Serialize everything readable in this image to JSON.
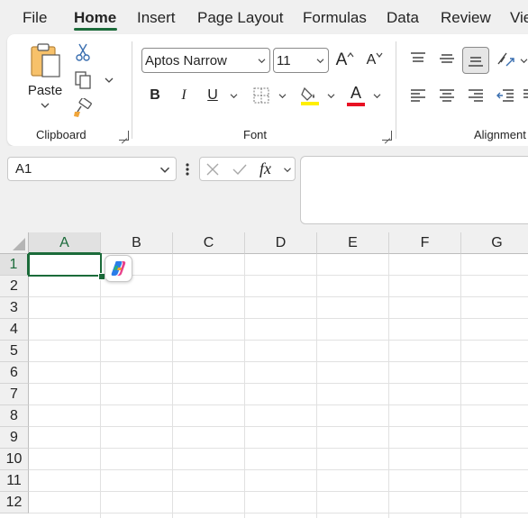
{
  "menu": {
    "tabs": [
      {
        "label": "File"
      },
      {
        "label": "Home",
        "active": true
      },
      {
        "label": "Insert"
      },
      {
        "label": "Page Layout"
      },
      {
        "label": "Formulas"
      },
      {
        "label": "Data"
      },
      {
        "label": "Review"
      },
      {
        "label": "Vie"
      }
    ]
  },
  "ribbon": {
    "clipboard": {
      "paste_label": "Paste",
      "group_label": "Clipboard"
    },
    "font": {
      "font_name": "Aptos Narrow",
      "font_size": "11",
      "bold": "B",
      "italic": "I",
      "underline": "U",
      "font_color_glyph": "A",
      "grow_glyph": "A",
      "shrink_glyph": "A",
      "group_label": "Font"
    },
    "alignment": {
      "group_label": "Alignment"
    }
  },
  "formula_bar": {
    "name_box": "A1",
    "fx_label": "fx",
    "formula": ""
  },
  "sheet": {
    "columns": [
      "A",
      "B",
      "C",
      "D",
      "E",
      "F",
      "G"
    ],
    "rows": [
      "1",
      "2",
      "3",
      "4",
      "5",
      "6",
      "7",
      "8",
      "9",
      "10",
      "11",
      "12"
    ],
    "selected_cell": "A1"
  },
  "colors": {
    "accent": "#1b6b3a",
    "highlight_yellow": "#ffef00",
    "font_red": "#e81123"
  }
}
